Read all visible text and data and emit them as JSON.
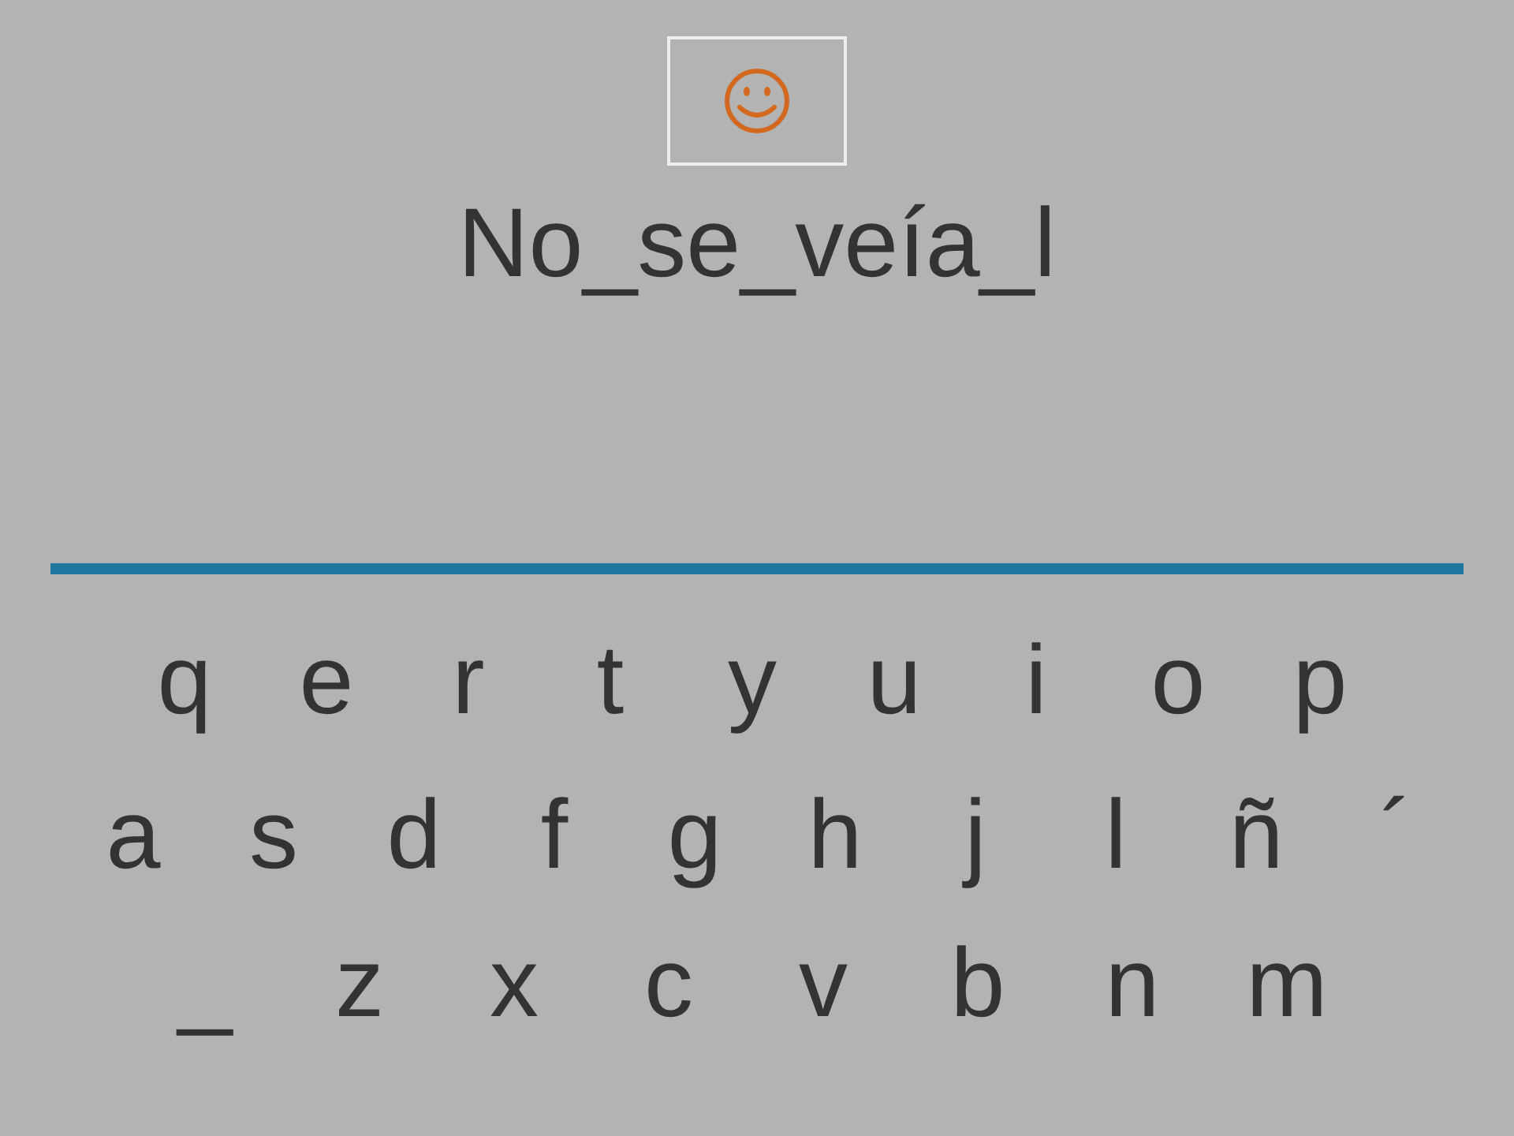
{
  "typed_text": "No_se_veía_l",
  "keyboard_rows": [
    [
      "q",
      "e",
      "r",
      "t",
      "y",
      "u",
      "i",
      "o",
      "p"
    ],
    [
      "a",
      "s",
      "d",
      "f",
      "g",
      "h",
      "j",
      "l",
      "ñ",
      "´"
    ],
    [
      "_",
      "z",
      "x",
      "c",
      "v",
      "b",
      "n",
      "m"
    ]
  ]
}
